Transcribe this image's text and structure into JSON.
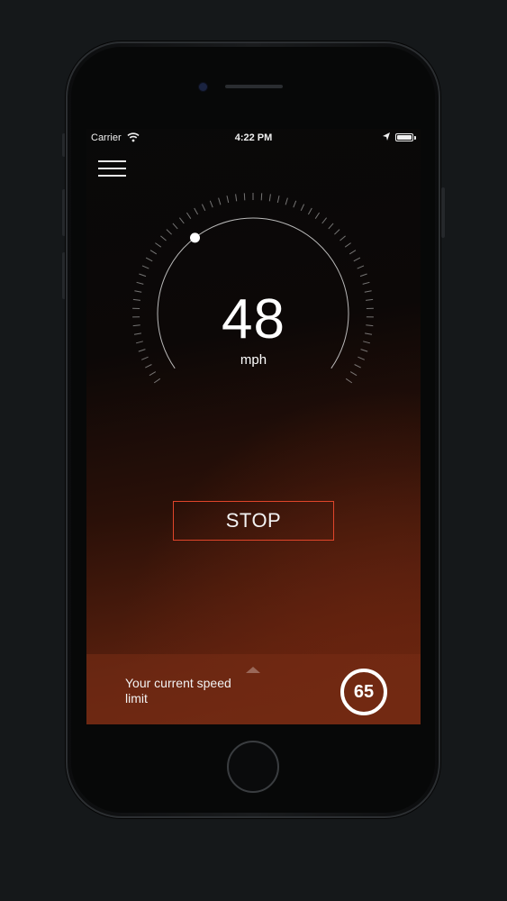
{
  "status_bar": {
    "carrier": "Carrier",
    "time": "4:22 PM"
  },
  "speedometer": {
    "speed": "48",
    "unit": "mph",
    "needle_level": 0.35
  },
  "controls": {
    "stop_label": "STOP"
  },
  "speed_limit_panel": {
    "label": "Your current speed limit",
    "limit_value": "65"
  },
  "colors": {
    "accent_red": "#e0452a",
    "background_gradient_end": "#6b2711"
  },
  "icons": {
    "menu": "hamburger-menu-icon",
    "wifi": "wifi-icon",
    "location": "location-arrow-icon",
    "battery": "battery-icon",
    "panel_toggle": "chevron-up-icon"
  }
}
